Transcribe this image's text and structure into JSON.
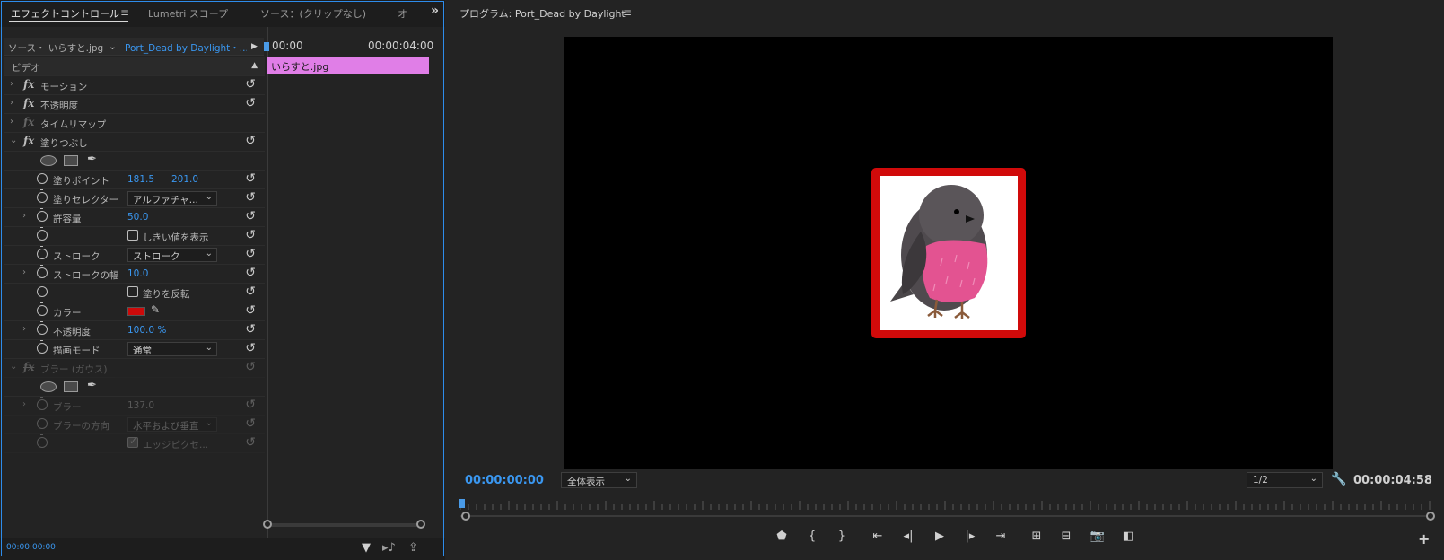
{
  "effect_controls": {
    "tabs": [
      {
        "label": "エフェクトコントロール"
      },
      {
        "label": "Lumetri スコープ"
      },
      {
        "label": "ソース：(クリップなし)"
      },
      {
        "label": "オ"
      }
    ],
    "source_label": "ソース・ いらすと.jpg",
    "sequence_label": "Port_Dead by Daylight・...",
    "timecode_start": "00:00",
    "timecode_end": "00:00:04:00",
    "clip_name": "いらすと.jpg",
    "section_video": "ビデオ",
    "effects": {
      "motion": "モーション",
      "opacity": "不透明度",
      "time_remap": "タイムリマップ",
      "paint_bucket": "塗りつぶし",
      "fill_point_label": "塗りポイント",
      "fill_point_x": "181.5",
      "fill_point_y": "201.0",
      "fill_selector_label": "塗りセレクター",
      "fill_selector_value": "アルファチャ...",
      "tolerance_label": "許容量",
      "tolerance_value": "50.0",
      "show_threshold_label": "しきい値を表示",
      "stroke_label": "ストローク",
      "stroke_value": "ストローク",
      "stroke_width_label": "ストロークの幅",
      "stroke_width_value": "10.0",
      "invert_fill_label": "塗りを反転",
      "color_label": "カラー",
      "color_value": "#cc0a0a",
      "opacity_label": "不透明度",
      "opacity_value": "100.0 %",
      "blend_mode_label": "描画モード",
      "blend_mode_value": "通常",
      "blur_gaussian": "ブラー (ガウス)",
      "blur_label": "ブラー",
      "blur_value": "137.0",
      "blur_dir_label": "ブラーの方向",
      "blur_dir_value": "水平および垂直",
      "edge_pixel_label": "エッジピクセ..."
    },
    "bottom_timecode": "00:00:00:00"
  },
  "program_monitor": {
    "title": "プログラム: Port_Dead by Daylight",
    "current_timecode": "00:00:00:00",
    "zoom_value": "全体表示",
    "resolution_value": "1/2",
    "duration_timecode": "00:00:04:58"
  },
  "colors": {
    "accent": "#2d8ceb",
    "clip": "#e07ee7",
    "frame_red": "#d10a0a"
  }
}
